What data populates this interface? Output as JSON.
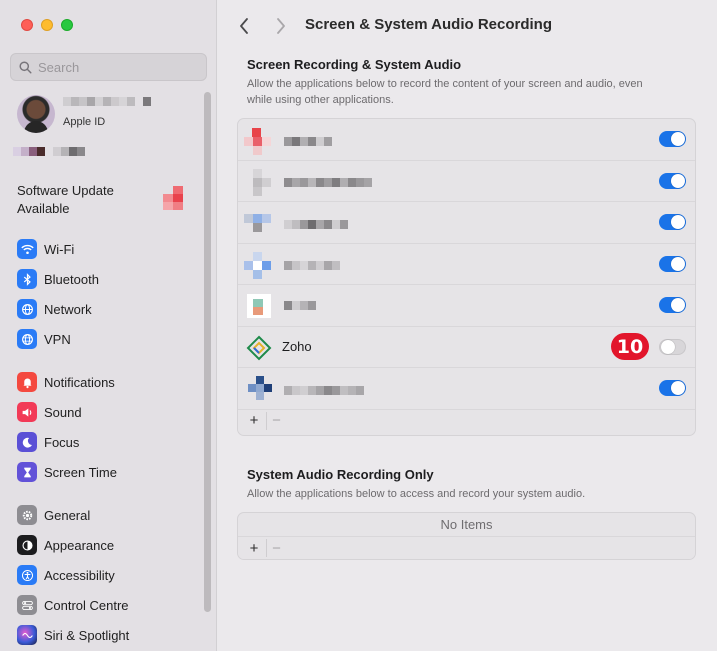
{
  "window": {
    "title": "Screen & System Audio Recording"
  },
  "sidebar": {
    "search_placeholder": "Search",
    "account": {
      "label": "Apple ID"
    },
    "software_update": {
      "label": "Software Update Available"
    },
    "groups": [
      [
        {
          "label": "Wi-Fi",
          "icon": "wifi-icon",
          "color": "#2a7bf6"
        },
        {
          "label": "Bluetooth",
          "icon": "bluetooth-icon",
          "color": "#2a7bf6"
        },
        {
          "label": "Network",
          "icon": "globe-icon",
          "color": "#2a7bf6"
        },
        {
          "label": "VPN",
          "icon": "vpn-globe-icon",
          "color": "#2a7bf6"
        }
      ],
      [
        {
          "label": "Notifications",
          "icon": "bell-icon",
          "color": "#f4493f"
        },
        {
          "label": "Sound",
          "icon": "speaker-icon",
          "color": "#f23a57"
        },
        {
          "label": "Focus",
          "icon": "moon-icon",
          "color": "#5b50d6"
        },
        {
          "label": "Screen Time",
          "icon": "hourglass-icon",
          "color": "#6252d8"
        }
      ],
      [
        {
          "label": "General",
          "icon": "gear-icon",
          "color": "#8e8d92"
        },
        {
          "label": "Appearance",
          "icon": "appearance-icon",
          "color": "#1c1c1e"
        },
        {
          "label": "Accessibility",
          "icon": "accessibility-icon",
          "color": "#2a7bf6"
        },
        {
          "label": "Control Centre",
          "icon": "control-centre-icon",
          "color": "#8e8d92"
        },
        {
          "label": "Siri & Spotlight",
          "icon": "siri-icon",
          "color": "#3b3b8e"
        }
      ]
    ]
  },
  "main": {
    "screen_section": {
      "title": "Screen Recording & System Audio",
      "description": "Allow the applications below to record the content of your screen and audio, even while using other applications.",
      "apps": [
        {
          "name": "",
          "enabled": true
        },
        {
          "name": "",
          "enabled": true
        },
        {
          "name": "",
          "enabled": true
        },
        {
          "name": "",
          "enabled": true
        },
        {
          "name": "",
          "enabled": true
        },
        {
          "name": "Zoho",
          "enabled": false,
          "badge": "10"
        },
        {
          "name": "",
          "enabled": true
        }
      ]
    },
    "audio_section": {
      "title": "System Audio Recording Only",
      "description": "Allow the applications below to access and record your system audio.",
      "empty_text": "No Items"
    },
    "footer": {
      "add": "+",
      "remove": "−"
    }
  },
  "colors": {
    "accent": "#1a73e8",
    "badge": "#e2152b"
  }
}
